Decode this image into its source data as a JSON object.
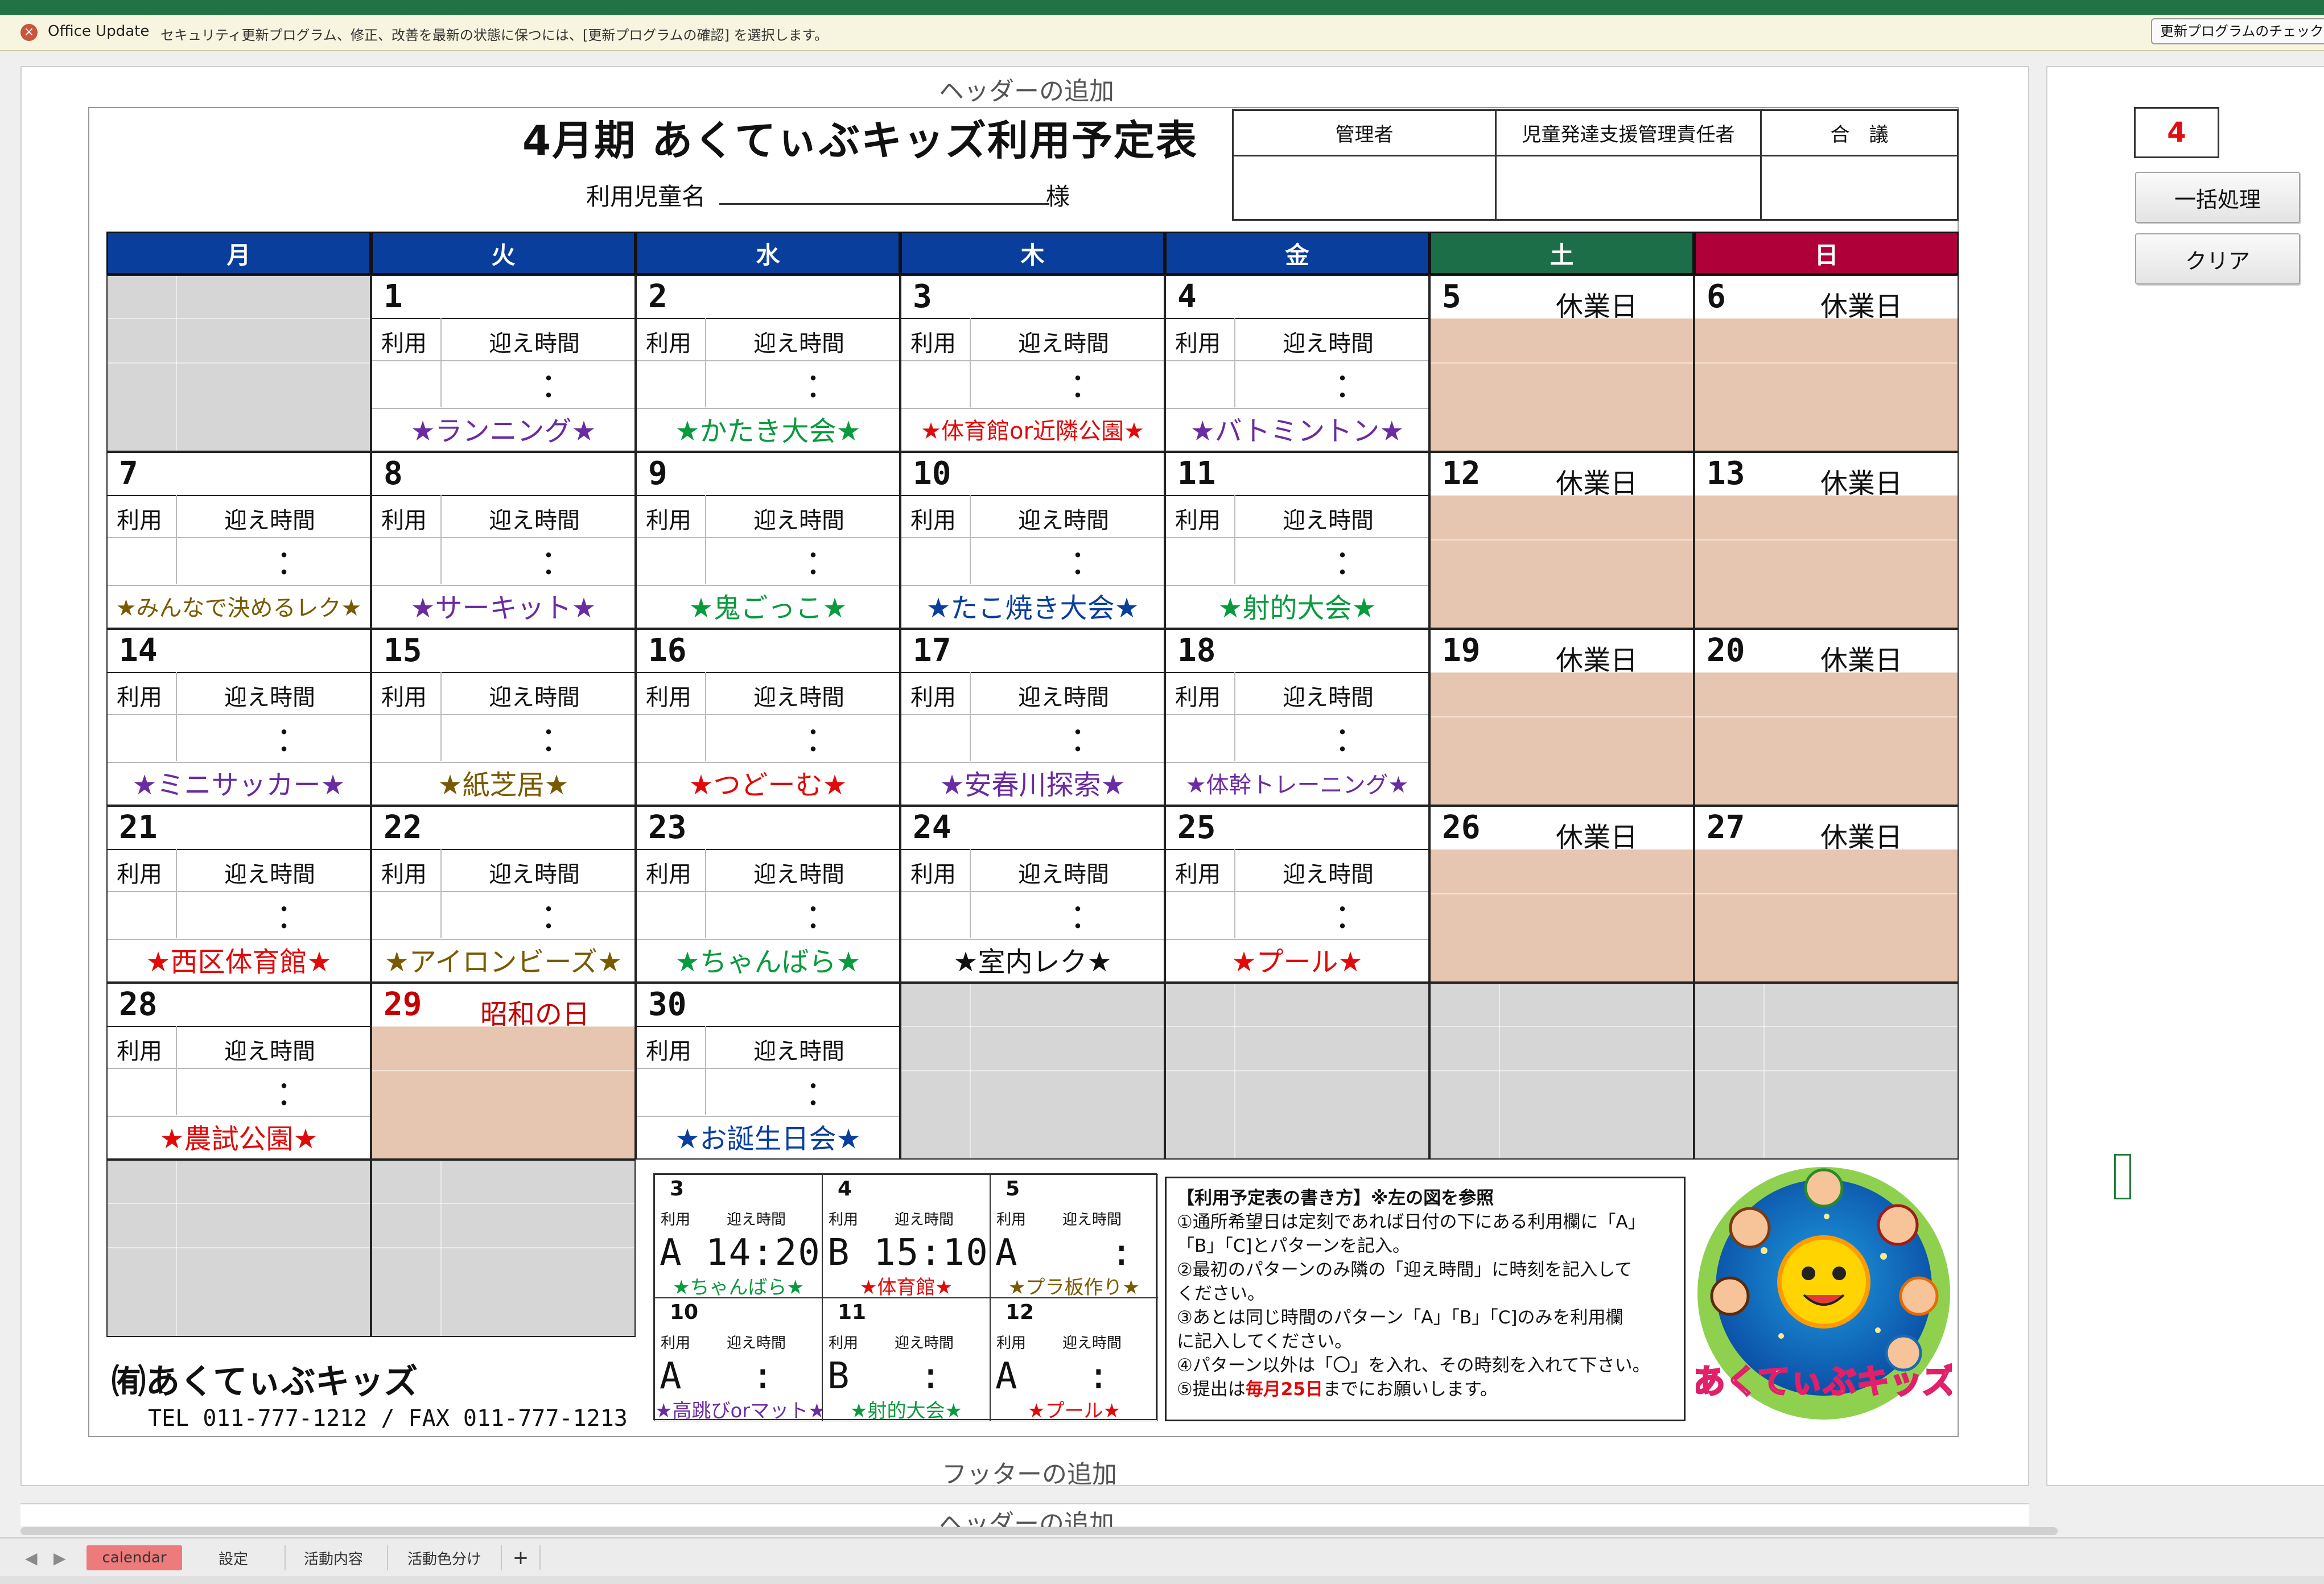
{
  "update": {
    "title": "Office Update",
    "message": "セキュリティ更新プログラム、修正、改善を最新の状態に保つには、[更新プログラムの確認] を選択します。",
    "button": "更新プログラムのチェック"
  },
  "sheet": {
    "header_add": "ヘッダーの追加",
    "footer_add": "フッターの追加",
    "header_add_next": "ヘッダーの追加"
  },
  "form": {
    "title": "4月期 あくてぃぶキッズ利用予定表",
    "name_label": "利用児童名",
    "name_suffix": "様",
    "signatures": [
      "管理者",
      "児童発達支援管理責任者",
      "合　議"
    ]
  },
  "weekdays": [
    {
      "label": "月",
      "color": "#0a3e9c"
    },
    {
      "label": "火",
      "color": "#0a3e9c"
    },
    {
      "label": "水",
      "color": "#0a3e9c"
    },
    {
      "label": "木",
      "color": "#0a3e9c"
    },
    {
      "label": "金",
      "color": "#0a3e9c"
    },
    {
      "label": "土",
      "color": "#1c6e48"
    },
    {
      "label": "日",
      "color": "#b0003a"
    }
  ],
  "labels": {
    "riyo": "利用",
    "mukae": "迎え時間",
    "colon": "・\n・"
  },
  "days": [
    {
      "type": "gray"
    },
    {
      "type": "day",
      "num": "1",
      "event": "★ランニング★",
      "color": "#6a2ca0"
    },
    {
      "type": "day",
      "num": "2",
      "event": "★かたき大会★",
      "color": "#0a9a3e"
    },
    {
      "type": "day",
      "num": "3",
      "event": "★体育館or近隣公園★",
      "color": "#e00a0a",
      "small": true
    },
    {
      "type": "day",
      "num": "4",
      "event": "★バトミントン★",
      "color": "#6a2ca0"
    },
    {
      "type": "holiday",
      "num": "5",
      "label": "休業日"
    },
    {
      "type": "holiday",
      "num": "6",
      "label": "休業日"
    },
    {
      "type": "day",
      "num": "7",
      "event": "★みんなで決めるレク★",
      "color": "#7a5a00",
      "small": true
    },
    {
      "type": "day",
      "num": "8",
      "event": "★サーキット★",
      "color": "#6a2ca0"
    },
    {
      "type": "day",
      "num": "9",
      "event": "★鬼ごっこ★",
      "color": "#0a9a3e"
    },
    {
      "type": "day",
      "num": "10",
      "event": "★たこ焼き大会★",
      "color": "#0a3e9c"
    },
    {
      "type": "day",
      "num": "11",
      "event": "★射的大会★",
      "color": "#0a9a3e"
    },
    {
      "type": "holiday",
      "num": "12",
      "label": "休業日"
    },
    {
      "type": "holiday",
      "num": "13",
      "label": "休業日"
    },
    {
      "type": "day",
      "num": "14",
      "event": "★ミニサッカー★",
      "color": "#6a2ca0"
    },
    {
      "type": "day",
      "num": "15",
      "event": "★紙芝居★",
      "color": "#7a5a00"
    },
    {
      "type": "day",
      "num": "16",
      "event": "★つどーむ★",
      "color": "#e00a0a"
    },
    {
      "type": "day",
      "num": "17",
      "event": "★安春川探索★",
      "color": "#6a2ca0"
    },
    {
      "type": "day",
      "num": "18",
      "event": "★体幹トレーニング★",
      "color": "#6a2ca0",
      "small": true
    },
    {
      "type": "holiday",
      "num": "19",
      "label": "休業日"
    },
    {
      "type": "holiday",
      "num": "20",
      "label": "休業日"
    },
    {
      "type": "day",
      "num": "21",
      "event": "★西区体育館★",
      "color": "#e00a0a"
    },
    {
      "type": "day",
      "num": "22",
      "event": "★アイロンビーズ★",
      "color": "#7a5a00"
    },
    {
      "type": "day",
      "num": "23",
      "event": "★ちゃんばら★",
      "color": "#0a9a3e"
    },
    {
      "type": "day",
      "num": "24",
      "event": "★室内レク★",
      "color": "#111111"
    },
    {
      "type": "day",
      "num": "25",
      "event": "★プール★",
      "color": "#e00a0a"
    },
    {
      "type": "holiday",
      "num": "26",
      "label": "休業日"
    },
    {
      "type": "holiday",
      "num": "27",
      "label": "休業日"
    },
    {
      "type": "day",
      "num": "28",
      "event": "★農試公園★",
      "color": "#e00a0a"
    },
    {
      "type": "pholiday",
      "num": "29",
      "label": "昭和の日",
      "color": "#c40000"
    },
    {
      "type": "day",
      "num": "30",
      "event": "★お誕生日会★",
      "color": "#0a3e9c"
    },
    {
      "type": "gray"
    },
    {
      "type": "gray"
    },
    {
      "type": "gray"
    },
    {
      "type": "gray"
    },
    {
      "type": "gray"
    },
    {
      "type": "gray"
    }
  ],
  "example": [
    {
      "num": "3",
      "hand": "A 14:20",
      "event": "★ちゃんばら★",
      "color": "#0a9a3e"
    },
    {
      "num": "4",
      "hand": "B 15:10",
      "event": "★体育館★",
      "color": "#e00a0a"
    },
    {
      "num": "5",
      "hand": "A    :",
      "event": "★プラ板作り★",
      "color": "#7a5a00"
    },
    {
      "num": "10",
      "hand": "A   :",
      "event": "★高跳びorマット★",
      "color": "#6a2ca0"
    },
    {
      "num": "11",
      "hand": "B   :",
      "event": "★射的大会★",
      "color": "#0a9a3e"
    },
    {
      "num": "12",
      "hand": "A   :",
      "event": "★プール★",
      "color": "#e00a0a"
    }
  ],
  "instructions": {
    "title": "【利用予定表の書き方】※左の図を参照",
    "l1": "①通所希望日は定刻であれば日付の下にある利用欄に「A」",
    "l2": "「B」「C]とパターンを記入。",
    "l3": "②最初のパターンのみ隣の「迎え時間」に時刻を記入して",
    "l4": "ください。",
    "l5": "③あとは同じ時間のパターン「A」「B」「C]のみを利用欄",
    "l6": "に記入してください。",
    "l7": "④パターン以外は「〇」を入れ、その時刻を入れて下さい。",
    "l8a": "⑤提出は",
    "l8b": "毎月25日",
    "l8c": "までにお願いします。"
  },
  "logo_text": "あくてぃぶキッズ",
  "company": "㈲あくてぃぶキッズ",
  "tel": "TEL 011-777-1212 / FAX 011-777-1213",
  "side": {
    "cell_value": "4",
    "btn_batch": "一括処理",
    "btn_clear": "クリア"
  },
  "tabs": [
    "calendar",
    "設定",
    "活動内容",
    "活動色分け",
    "+"
  ]
}
